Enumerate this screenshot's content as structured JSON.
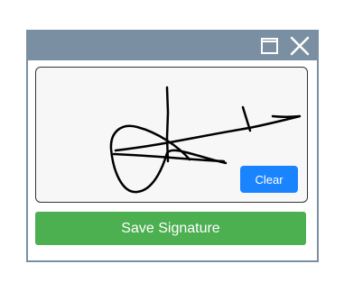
{
  "window": {
    "maximize_icon": "maximize-icon",
    "close_icon": "close-icon",
    "titlebar_color": "#7a90a2"
  },
  "signature_pad": {
    "background": "#f7f7f7",
    "stroke_color": "#000000",
    "clear_label": "Clear",
    "clear_color": "#1a84ff"
  },
  "actions": {
    "save_label": "Save Signature",
    "save_color": "#4caf50"
  }
}
